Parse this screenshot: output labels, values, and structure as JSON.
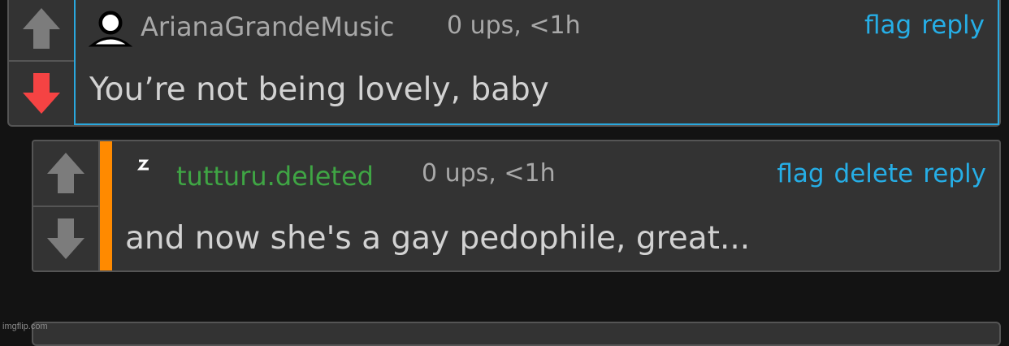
{
  "comments": [
    {
      "username": "ArianaGrandeMusic",
      "meta": "0 ups, <1h",
      "actions": [
        "flag",
        "reply"
      ],
      "text": "You’re not being lovely, baby",
      "upvote_active": false,
      "downvote_active": true,
      "username_color": "#a8a8a8",
      "avatar_icon": "user-silhouette-icon"
    },
    {
      "username": "tutturu.deleted",
      "meta": "0 ups, <1h",
      "actions": [
        "flag",
        "delete",
        "reply"
      ],
      "text": "and now she's a gay pedophile, great...",
      "upvote_active": false,
      "downvote_active": false,
      "username_color": "#3fa544",
      "accent_color": "#ff8a00",
      "avatar_icon": "lightning-icon"
    }
  ],
  "colors": {
    "background": "#131313",
    "panel": "#333333",
    "link": "#26aee6",
    "downvote_active": "#f54343",
    "vote_inactive": "#7c7c7c",
    "highlight_border": "#2aa8de"
  },
  "watermark": "imgflip.com"
}
